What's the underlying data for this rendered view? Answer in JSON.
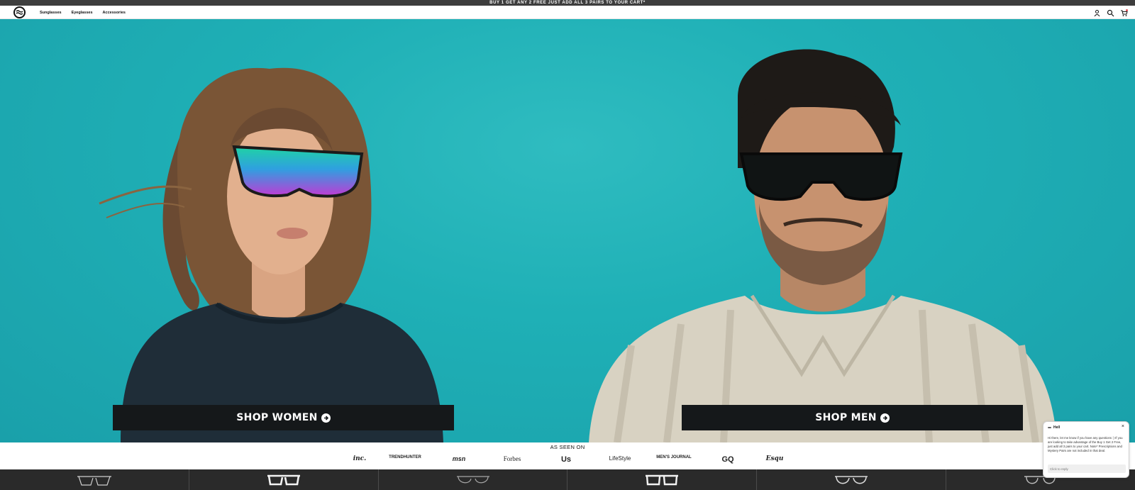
{
  "announcement": {
    "text": "BUY 1 GET ANY 2 FREE JUST ADD ALL 3 PAIRS TO YOUR CART*"
  },
  "header": {
    "logo_icon": "logo-wave-icon",
    "nav": [
      {
        "label": "Sunglasses"
      },
      {
        "label": "Eyeglasses"
      },
      {
        "label": "Accessories"
      }
    ],
    "icons": [
      "account-icon",
      "search-icon",
      "cart-icon"
    ]
  },
  "hero": {
    "background_color": "#1fb0b6",
    "shop_women_label": "SHOP WOMEN",
    "shop_men_label": "SHOP MEN"
  },
  "press": {
    "title": "AS SEEN ON",
    "logos": [
      "inc.",
      "TRENDHUNTER",
      "msn",
      "Forbes",
      "Us",
      "LifeStyle",
      "MEN'S JOURNAL",
      "GQ",
      "Esqu"
    ]
  },
  "chat": {
    "title": "Hell",
    "message": "Hi there, let me know if you have any questions :) If you are looking to take advantage of the Buy 1 Get 2 Free, just add all 3 pairs to your cart. Note* Prescriptions and Mystery Pairs are not included in that deal.",
    "input_placeholder": "Click to reply",
    "close_label": "×"
  }
}
